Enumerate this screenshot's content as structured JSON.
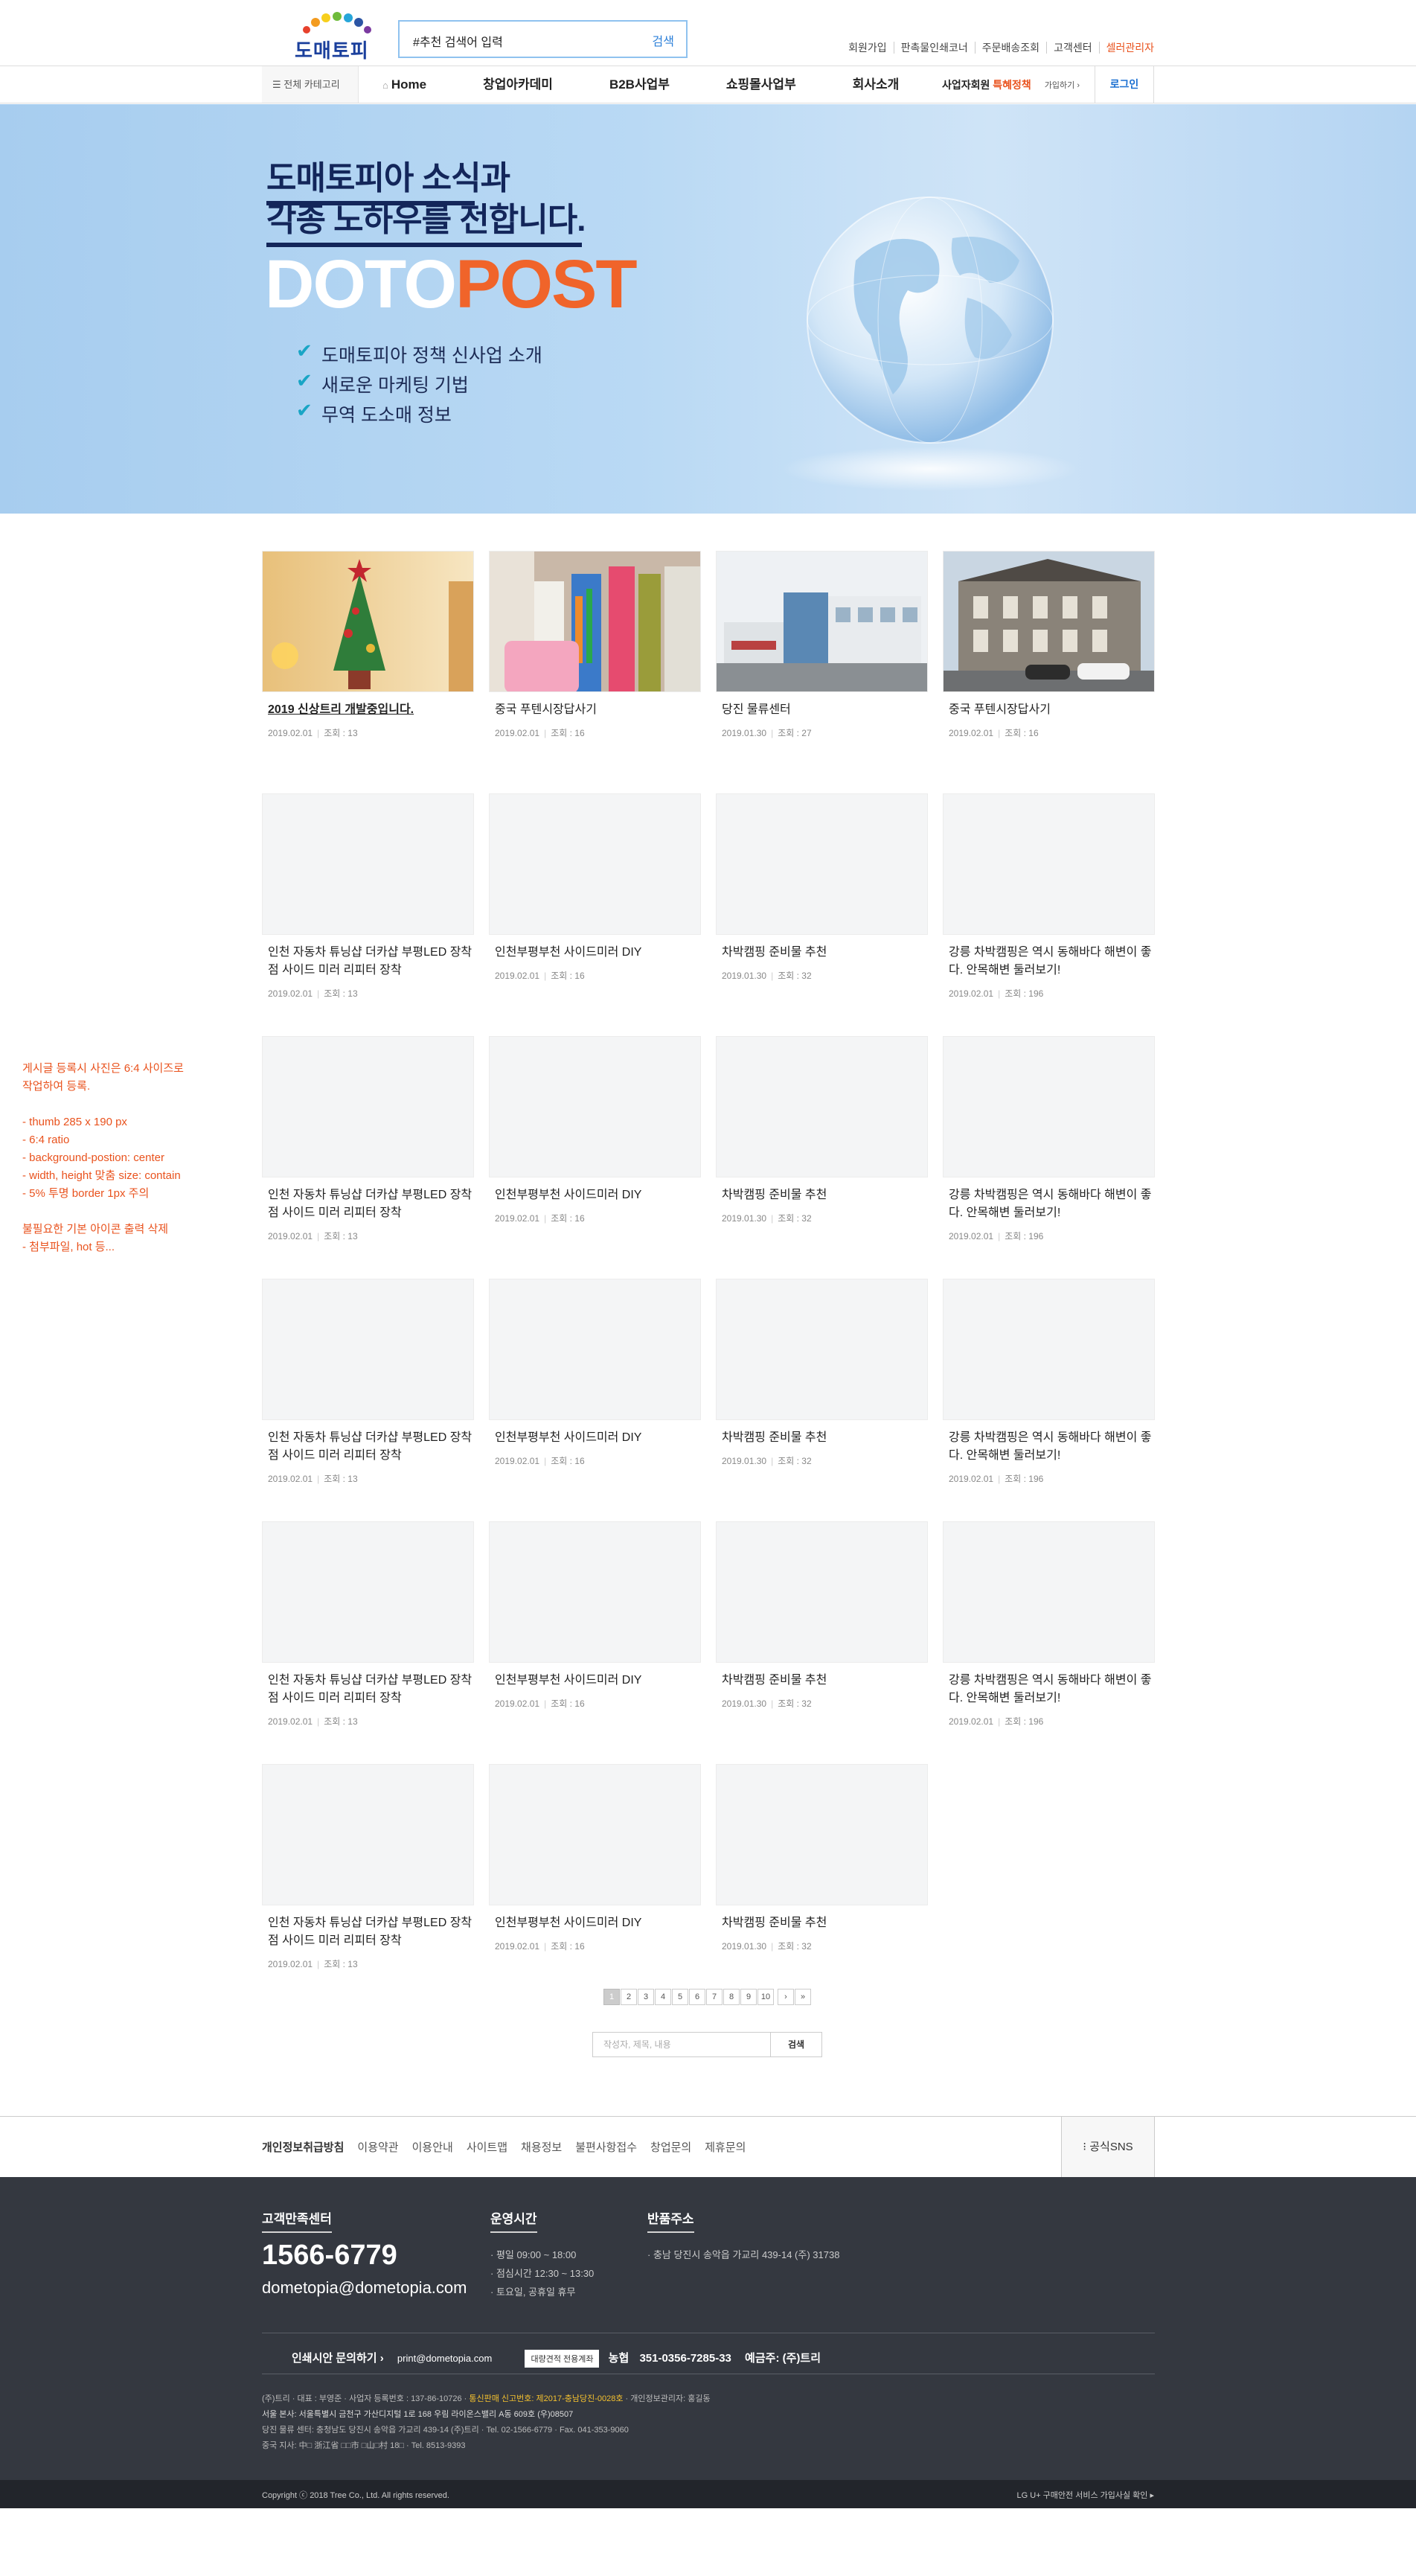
{
  "header": {
    "logo_text": "도매토피아",
    "search_query": "#추천 검색어 입력",
    "search_button": "검색",
    "top_links": [
      "회원가입",
      "판촉물인쇄코너",
      "주문배송조회",
      "고객센터",
      "셀러관리자"
    ]
  },
  "gnb": {
    "category": "전체 카테고리",
    "menu": [
      "Home",
      "창업아카데미",
      "B2B사업부",
      "쇼핑몰사업부",
      "회사소개"
    ],
    "biz_prefix": "사업자회원",
    "biz_highlight": "특혜정책",
    "join": "가입하기 ›",
    "login": "로그인"
  },
  "banner": {
    "line1": "도매토피아 소식과",
    "line2": "각종 노하우를 전합니다.",
    "dot": "DOTO",
    "post": "POST",
    "bullets": [
      "도매토피아 정책 신사업 소개",
      "새로운 마케팅 기법",
      "무역 도소매 정보"
    ]
  },
  "posts": [
    {
      "title": "2019 신상트리 개발중입니다.",
      "date": "2019.02.01",
      "views": "조회 : 13",
      "img": "tree",
      "underline": true
    },
    {
      "title": "중국 푸텐시장답사기",
      "date": "2019.02.01",
      "views": "조회 : 16",
      "img": "market"
    },
    {
      "title": "당진 물류센터",
      "date": "2019.01.30",
      "views": "조회 : 27",
      "img": "building"
    },
    {
      "title": "중국 푸텐시장답사기",
      "date": "2019.02.01",
      "views": "조회 : 16",
      "img": "house"
    },
    {
      "title": "인천 자동차 튜닝샵 더카샵 부평LED 장착점 사이드 미러 리피터 장착",
      "date": "2019.02.01",
      "views": "조회 : 13"
    },
    {
      "title": "인천부평부천 사이드미러 DIY",
      "date": "2019.02.01",
      "views": "조회 : 16"
    },
    {
      "title": "차박캠핑 준비물 추천",
      "date": "2019.01.30",
      "views": "조회 : 32"
    },
    {
      "title": "강릉 차박캠핑은 역시 동해바다 해변이 좋다. 안목해변 둘러보기!",
      "date": "2019.02.01",
      "views": "조회 : 196"
    },
    {
      "title": "인천 자동차 튜닝샵 더카샵 부평LED 장착점 사이드 미러 리피터 장착",
      "date": "2019.02.01",
      "views": "조회 : 13"
    },
    {
      "title": "인천부평부천 사이드미러 DIY",
      "date": "2019.02.01",
      "views": "조회 : 16"
    },
    {
      "title": "차박캠핑 준비물 추천",
      "date": "2019.01.30",
      "views": "조회 : 32"
    },
    {
      "title": "강릉 차박캠핑은 역시 동해바다 해변이 좋다. 안목해변 둘러보기!",
      "date": "2019.02.01",
      "views": "조회 : 196"
    },
    {
      "title": "인천 자동차 튜닝샵 더카샵 부평LED 장착점 사이드 미러 리피터 장착",
      "date": "2019.02.01",
      "views": "조회 : 13"
    },
    {
      "title": "인천부평부천 사이드미러 DIY",
      "date": "2019.02.01",
      "views": "조회 : 16"
    },
    {
      "title": "차박캠핑 준비물 추천",
      "date": "2019.01.30",
      "views": "조회 : 32"
    },
    {
      "title": "강릉 차박캠핑은 역시 동해바다 해변이 좋다. 안목해변 둘러보기!",
      "date": "2019.02.01",
      "views": "조회 : 196"
    },
    {
      "title": "인천 자동차 튜닝샵 더카샵 부평LED 장착점 사이드 미러 리피터 장착",
      "date": "2019.02.01",
      "views": "조회 : 13"
    },
    {
      "title": "인천부평부천 사이드미러 DIY",
      "date": "2019.02.01",
      "views": "조회 : 16"
    },
    {
      "title": "차박캠핑 준비물 추천",
      "date": "2019.01.30",
      "views": "조회 : 32"
    },
    {
      "title": "강릉 차박캠핑은 역시 동해바다 해변이 좋다. 안목해변 둘러보기!",
      "date": "2019.02.01",
      "views": "조회 : 196"
    },
    {
      "title": "인천 자동차 튜닝샵 더카샵 부평LED 장착점 사이드 미러 리피터 장착",
      "date": "2019.02.01",
      "views": "조회 : 13"
    },
    {
      "title": "인천부평부천 사이드미러 DIY",
      "date": "2019.02.01",
      "views": "조회 : 16"
    },
    {
      "title": "차박캠핑 준비물 추천",
      "date": "2019.01.30",
      "views": "조회 : 32"
    }
  ],
  "note": {
    "lines": [
      "게시글 등록시 사진은 6:4 사이즈로",
      "작업하여 등록.",
      "",
      "- thumb 285 x 190 px",
      "- 6:4 ratio",
      "- background-postion: center",
      "- width, height 맞춤 size: contain",
      "- 5% 투명 border 1px 주의",
      "",
      "불필요한 기본 아이콘 출력 삭제",
      "- 첨부파일, hot 등..."
    ]
  },
  "paging": {
    "pages": [
      "1",
      "2",
      "3",
      "4",
      "5",
      "6",
      "7",
      "8",
      "9",
      "10"
    ],
    "next": "›",
    "last": "»",
    "current": "1"
  },
  "board_search": {
    "placeholder": "작성자, 제목, 내용",
    "button": "검색"
  },
  "footer_links": {
    "items": [
      "개인정보취급방침",
      "이용약관",
      "이용안내",
      "사이트맵",
      "채용정보",
      "불편사항접수",
      "창업문의",
      "제휴문의"
    ],
    "sns": "공식SNS"
  },
  "footer": {
    "cs_title": "고객만족센터",
    "phone": "1566-6779",
    "email": "dometopia@dometopia.com",
    "hours_title": "운영시간",
    "hours": [
      "· 평일 09:00 ~ 18:00",
      "· 점심시간 12:30 ~ 13:30",
      "· 토요일, 공휴일 휴무"
    ],
    "return_title": "반품주소",
    "return_addr": "· 충남 당진시 송악읍 가교리 439-14 (주) 31738",
    "print_label": "인쇄시안 문의하기",
    "print_mail": "print@dometopia.com",
    "bank_tag": "대량견적 전용계좌",
    "bank_name": "농협",
    "bank_no": "351-0356-7285-33",
    "bank_owner": "예금주: (주)트리",
    "addr1a": "(주)트리  ·  대표 : 부영준  ·  사업자 등록번호 : 137-86-10726  ·",
    "addr1b": "통신판매 신고번호: 제2017-충남당진-0028호",
    "addr1c": "  ·  개인정보관리자: 홍길동",
    "addr2": "서울 본사: 서울특별시 금천구 가산디지털 1로 168 우림 라이온스밸리 A동 609호 (우)08507",
    "addr3": "당진 물류 센터: 충청남도 당진시 송악읍 가교리 439-14 (주)트리  ·  Tel. 02-1566-6779  ·  Fax. 041-353-9060",
    "addr4": "중국 지사: 中□ 浙江省 □□市 □山□村 18□  ·  Tel. 8513-9393",
    "copyright": "Copyright ⓒ 2018 Tree Co., Ltd. All rights reserved.",
    "escrow": "LG U+ 구매안전 서비스 가입사실 확인"
  },
  "colors": {
    "accent": "#e9521d",
    "brand": "#1a3f9c",
    "link": "#1a6fd1",
    "footer_bg": "#343840"
  }
}
